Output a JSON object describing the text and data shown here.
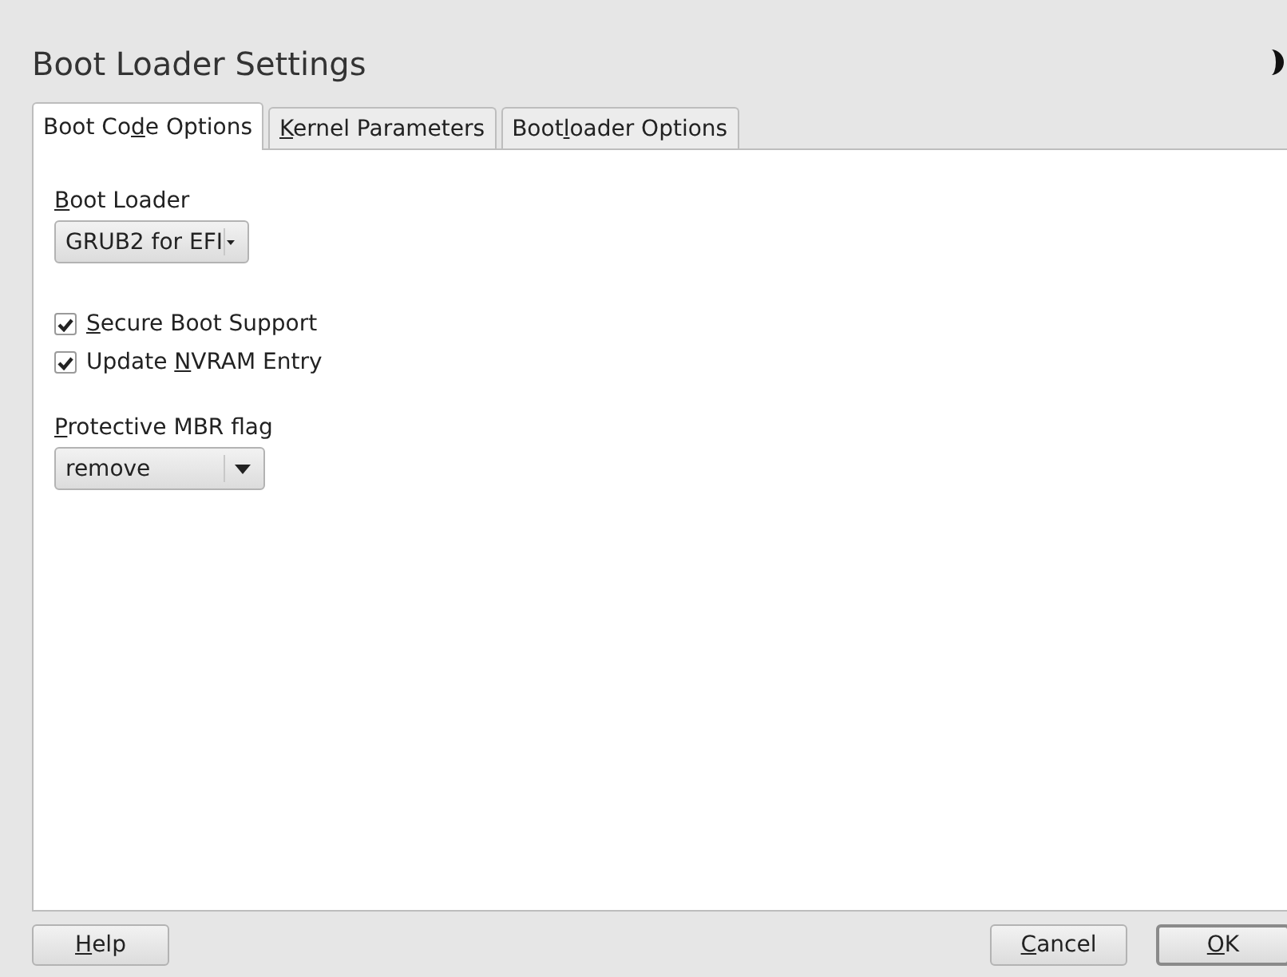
{
  "dialog": {
    "title": "Boot Loader Settings"
  },
  "tabs": [
    {
      "label": {
        "before": "Boot Co",
        "key": "d",
        "after": "e Options"
      },
      "selected": true
    },
    {
      "label": {
        "key": "K",
        "after": "ernel Parameters"
      },
      "selected": false
    },
    {
      "label": {
        "before": "Boot",
        "key": "l",
        "after": "oader Options"
      },
      "selected": false
    }
  ],
  "boot_loader": {
    "label": {
      "key": "B",
      "after": "oot Loader"
    },
    "value": "GRUB2 for EFI",
    "compact": true
  },
  "checkboxes": [
    {
      "label": {
        "key": "S",
        "after": "ecure Boot Support"
      },
      "checked": true
    },
    {
      "label": {
        "before": "Update ",
        "key": "N",
        "after": "VRAM Entry"
      },
      "checked": true
    }
  ],
  "protective_mbr": {
    "label": {
      "key": "P",
      "after": "rotective MBR flag"
    },
    "value": "remove",
    "compact": false
  },
  "buttons": [
    {
      "kind": "help",
      "label": {
        "key": "H",
        "after": "elp"
      },
      "default": false
    },
    {
      "kind": "action",
      "label": {
        "key": "C",
        "after": "ancel"
      },
      "default": false
    },
    {
      "kind": "action",
      "label": {
        "key": "O",
        "after": "K"
      },
      "default": true
    }
  ]
}
